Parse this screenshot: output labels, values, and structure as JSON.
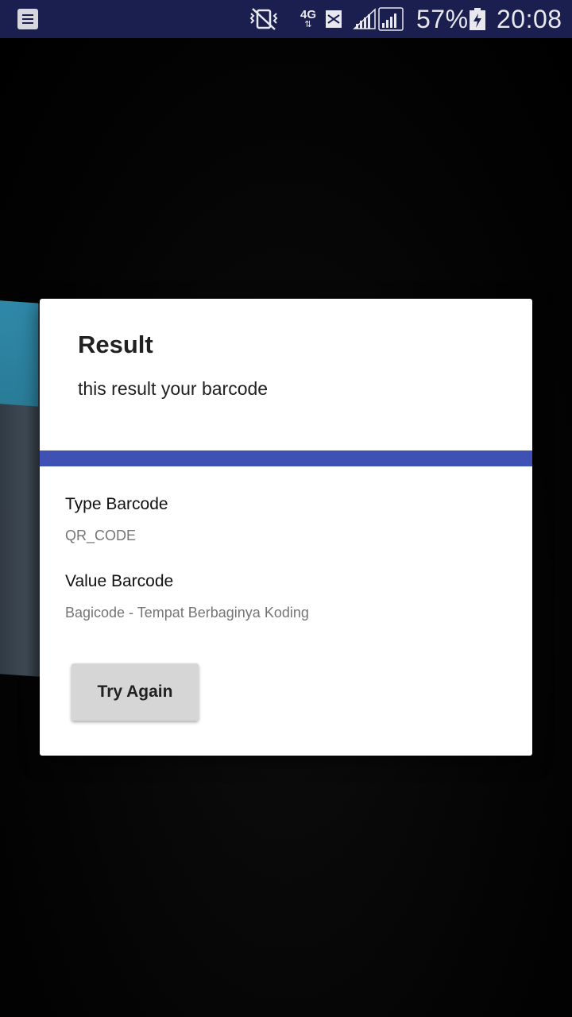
{
  "status_bar": {
    "network_type": "4G",
    "battery_percent": "57%",
    "time": "20:08",
    "icons": [
      "notification-icon",
      "vibrate-icon",
      "network-4g-icon",
      "sms-icon",
      "signal-icon",
      "signal-icon",
      "battery-charging-icon"
    ]
  },
  "dialog": {
    "title": "Result",
    "message": "this result your barcode",
    "accent_color": "#3f51b5",
    "type_label": "Type Barcode",
    "type_value": "QR_CODE",
    "value_label": "Value Barcode",
    "value_value": "Bagicode - Tempat Berbaginya Koding",
    "try_again_label": "Try Again"
  }
}
